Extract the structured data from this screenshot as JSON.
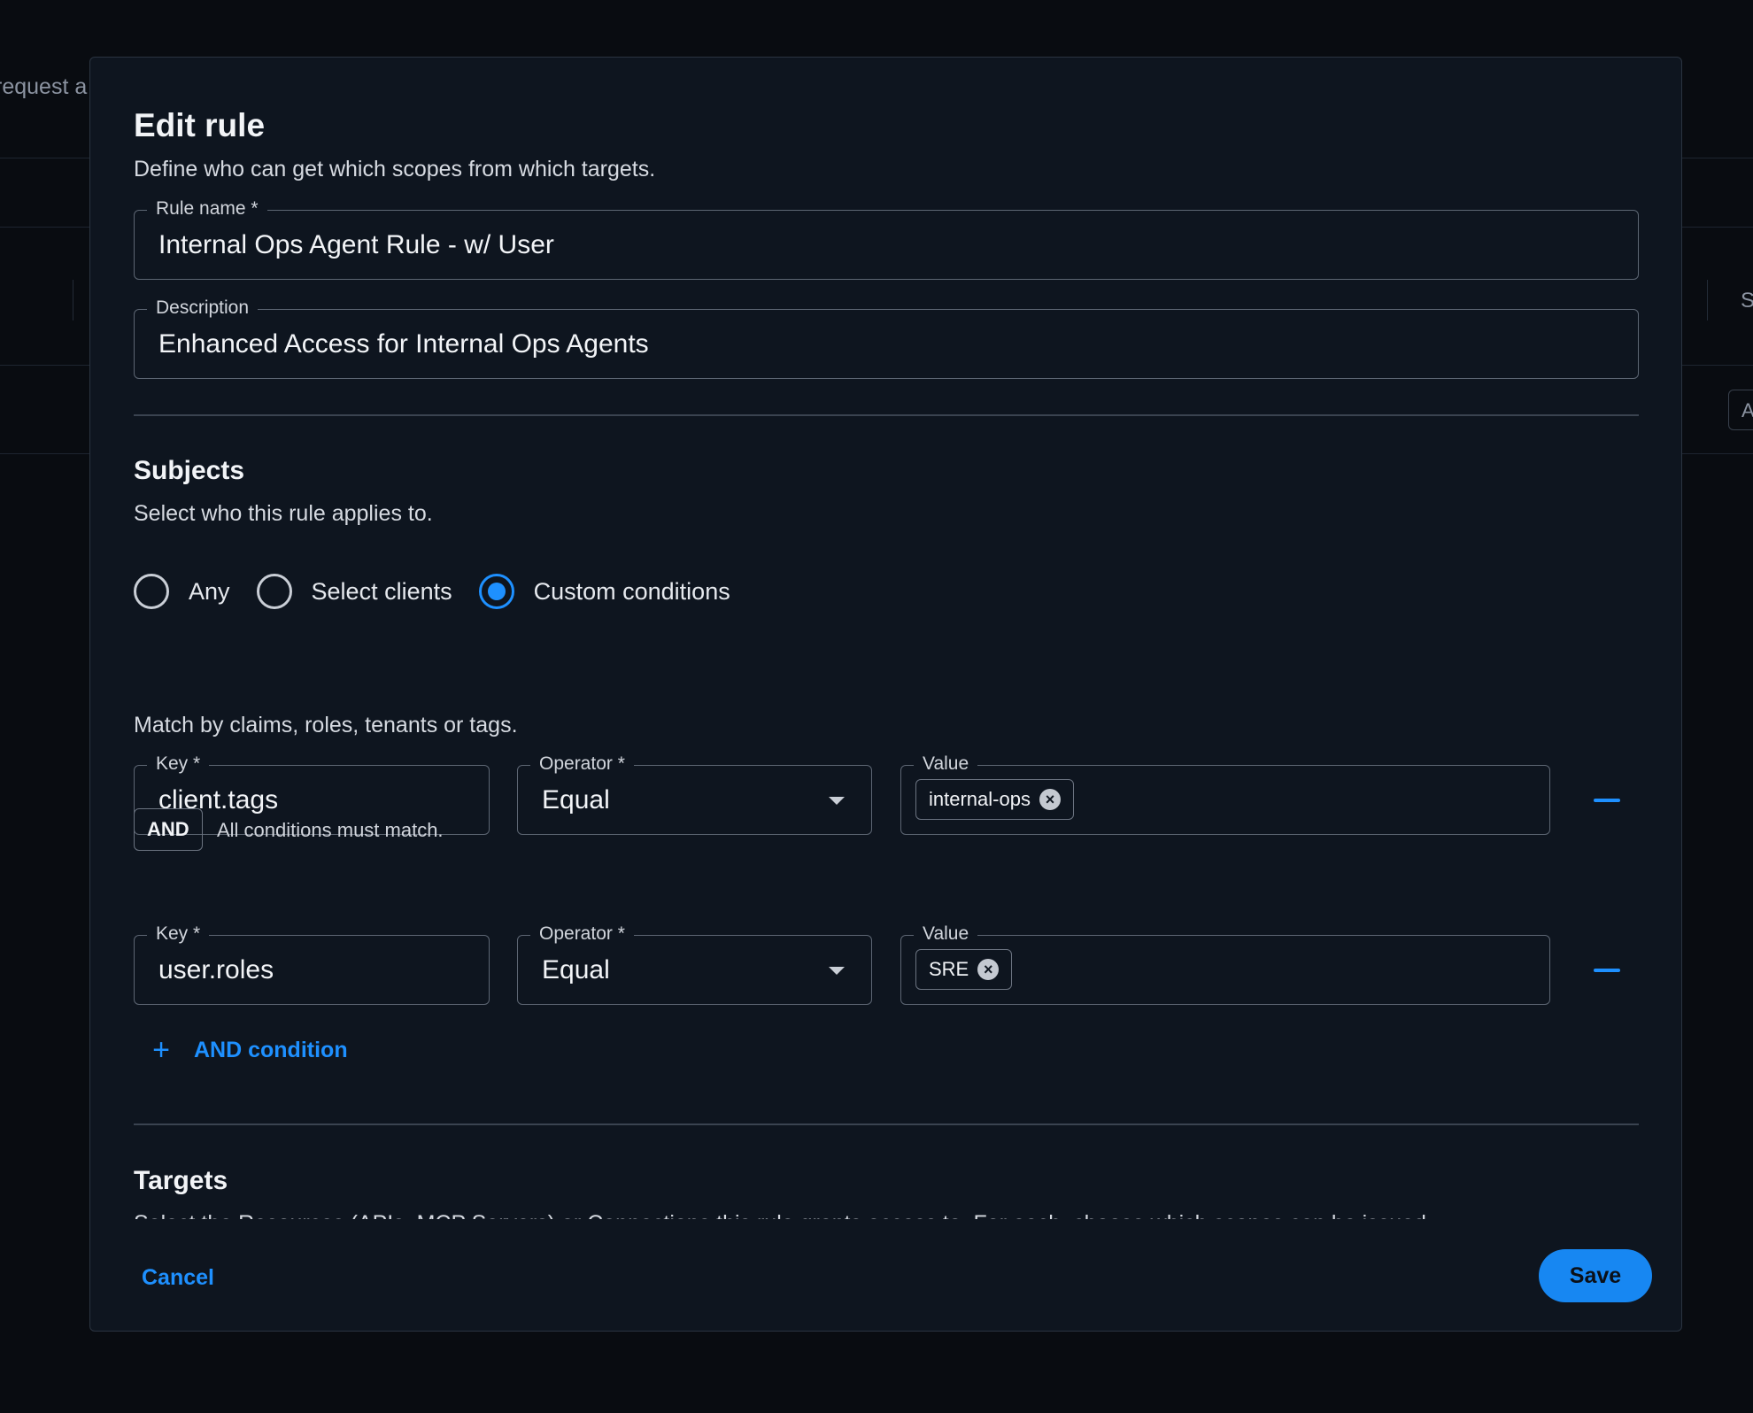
{
  "background": {
    "partial_text": "request a",
    "right_letter": "S",
    "right_box": "A"
  },
  "dialog": {
    "title": "Edit rule",
    "subtitle": "Define who can get which scopes from which targets.",
    "rule_name": {
      "label": "Rule name *",
      "value": "Internal Ops Agent Rule - w/ User"
    },
    "description": {
      "label": "Description",
      "value": "Enhanced Access for Internal Ops Agents"
    },
    "subjects": {
      "title": "Subjects",
      "subtitle": "Select who this rule applies to.",
      "options": [
        {
          "label": "Any",
          "checked": false
        },
        {
          "label": "Select clients",
          "checked": false
        },
        {
          "label": "Custom conditions",
          "checked": true
        }
      ],
      "match_help": "Match by claims, roles, tenants or tags.",
      "conditions": [
        {
          "key_label": "Key *",
          "key": "client.tags",
          "operator_label": "Operator *",
          "operator": "Equal",
          "value_label": "Value",
          "values": [
            "internal-ops"
          ]
        },
        {
          "key_label": "Key *",
          "key": "user.roles",
          "operator_label": "Operator *",
          "operator": "Equal",
          "value_label": "Value",
          "values": [
            "SRE"
          ]
        }
      ],
      "and_badge": "AND",
      "and_help": "All conditions must match.",
      "add_condition": "AND condition"
    },
    "targets": {
      "title": "Targets",
      "subtitle": "Select the Resources (APIs, MCP Servers) or Connections this rule grants access to. For each, choose which scopes can be issued."
    },
    "footer": {
      "cancel": "Cancel",
      "save": "Save"
    }
  },
  "colors": {
    "accent": "#1e90ff",
    "dialog_bg": "#0e151f",
    "page_bg": "#07090d"
  }
}
